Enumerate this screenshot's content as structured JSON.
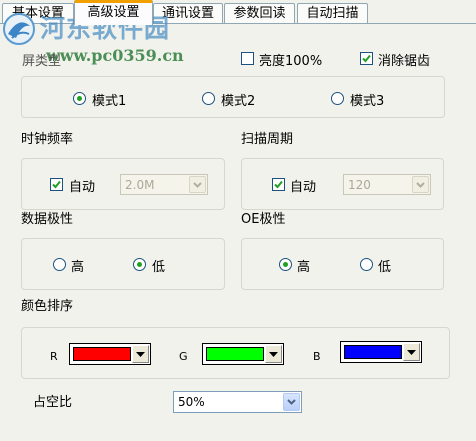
{
  "tabs": [
    {
      "label": "基本设置"
    },
    {
      "label": "高级设置"
    },
    {
      "label": "通讯设置"
    },
    {
      "label": "参数回读"
    },
    {
      "label": "自动扫描"
    }
  ],
  "watermark": {
    "title": "河东软件园",
    "url": "www.pc0359.cn"
  },
  "scan_type": {
    "label": "屏类型",
    "brightness_label": "亮度100%",
    "brightness_checked": false,
    "antialias_label": "消除锯齿",
    "antialias_checked": true,
    "modes": [
      {
        "label": "模式1",
        "selected": true
      },
      {
        "label": "模式2",
        "selected": false
      },
      {
        "label": "模式3",
        "selected": false
      }
    ]
  },
  "clock": {
    "label": "时钟频率",
    "auto_label": "自动",
    "auto_checked": true,
    "value": "2.0M"
  },
  "scan_period": {
    "label": "扫描周期",
    "auto_label": "自动",
    "auto_checked": true,
    "value": "120"
  },
  "data_polarity": {
    "label": "数据极性",
    "high_label": "高",
    "low_label": "低",
    "selected": "low"
  },
  "oe_polarity": {
    "label": "OE极性",
    "high_label": "高",
    "low_label": "低",
    "selected": "high"
  },
  "color_order": {
    "label": "颜色排序",
    "channels": [
      {
        "label": "R",
        "color": "#ff0000"
      },
      {
        "label": "G",
        "color": "#00ff00"
      },
      {
        "label": "B",
        "color": "#0000ff"
      }
    ]
  },
  "duty": {
    "label": "占空比",
    "value": "50%"
  }
}
